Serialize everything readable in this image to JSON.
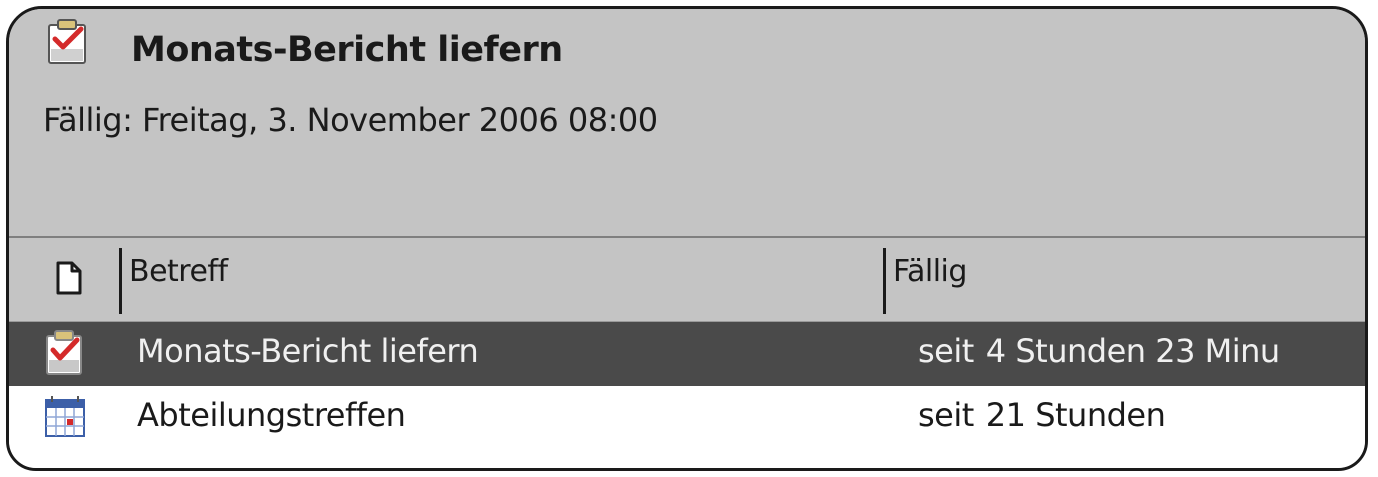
{
  "item": {
    "title": "Monats-Bericht liefern",
    "due_line": "Fällig: Freitag, 3. November 2006 08:00",
    "icon": "task-icon"
  },
  "list": {
    "columns": {
      "type_icon": "document-icon",
      "subject": "Betreff",
      "due": "Fällig"
    },
    "rows": [
      {
        "icon": "task-icon",
        "subject": "Monats-Bericht liefern",
        "due_prefix": "seit",
        "due_value": "4 Stunden 23 Minu",
        "selected": true
      },
      {
        "icon": "calendar-icon",
        "subject": "Abteilungstreffen",
        "due_prefix": "seit",
        "due_value": "21 Stunden",
        "selected": false
      }
    ]
  },
  "colors": {
    "header_bg": "#c4c4c4",
    "selected_row_bg": "#4a4a4a",
    "list_bg": "#ffffff"
  }
}
